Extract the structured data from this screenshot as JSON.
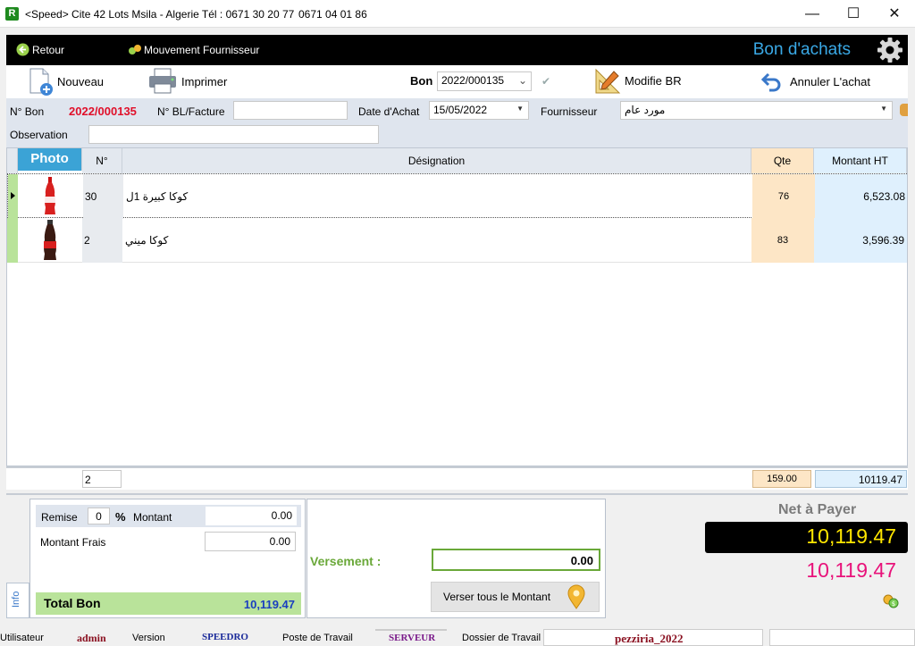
{
  "window": {
    "title": "<Speed>  Cite 42 Lots Msila - Algerie Tél : 0671 30 20 77",
    "phone2": "0671 04 01 86",
    "controls": {
      "minimize": "—",
      "maximize": "☐",
      "close": "✕"
    },
    "logo_letter": "R"
  },
  "topbar": {
    "back_label": "Retour",
    "supplier_moves_label": "Mouvement Fournisseur",
    "page_title": "Bon d'achats"
  },
  "toolbar": {
    "new_label": "Nouveau",
    "print_label": "Imprimer",
    "bon_label": "Bon",
    "bon_value": "2022/000135",
    "modify_label": "Modifie BR",
    "cancel_label": "Annuler L'achat"
  },
  "form": {
    "no_bon_label": "N° Bon",
    "no_bon_value": "2022/000135",
    "bl_label": "N° BL/Facture",
    "bl_value": "",
    "date_label": "Date d'Achat",
    "date_value": "15/05/2022",
    "supplier_label": "Fournisseur",
    "supplier_value": "مورد عام",
    "observation_label": "Observation",
    "observation_value": ""
  },
  "grid": {
    "columns": [
      "Photo",
      "N°",
      "Désignation",
      "Qte",
      "Montant HT"
    ],
    "rows": [
      {
        "num": "30",
        "designation": "كوكا كبيرة 1ل",
        "qty": "76",
        "amount": "6,523.08"
      },
      {
        "num": "2",
        "designation": "كوكا ميني",
        "qty": "83",
        "amount": "3,596.39"
      }
    ],
    "footer": {
      "count": "2",
      "qty_total": "159.00",
      "amount_total": "10119.47"
    }
  },
  "totals": {
    "remise_label": "Remise",
    "remise_value": "0",
    "percent_sign": "%",
    "montant_label": "Montant",
    "montant_value": "0.00",
    "frais_label": "Montant Frais",
    "frais_value": "0.00",
    "total_bon_label": "Total Bon",
    "total_bon_value": "10,119.47",
    "info_tab": "Info",
    "versement_label": "Versement :",
    "versement_value": "0.00",
    "verser_button": "Verser tous le Montant",
    "net_label": "Net à Payer",
    "net_value": "10,119.47",
    "net_value2": "10,119.47"
  },
  "status": {
    "user_label": "Utilisateur",
    "user_value": "admin",
    "version_label": "Version",
    "version_value": "SPEEDRO",
    "poste_label": "Poste de Travail",
    "poste_value": "SERVEUR",
    "dossier_label": "Dossier de Travail",
    "dossier_value": "pezziria_2022"
  },
  "colors": {
    "accent_blue": "#3aa9e6",
    "bon_red": "#e0102a",
    "net_yellow": "#ffe600",
    "net_pink": "#e8127a",
    "total_green": "#b9e39a",
    "qty_bg": "#fde6c6",
    "amount_bg": "#dff0fd"
  }
}
